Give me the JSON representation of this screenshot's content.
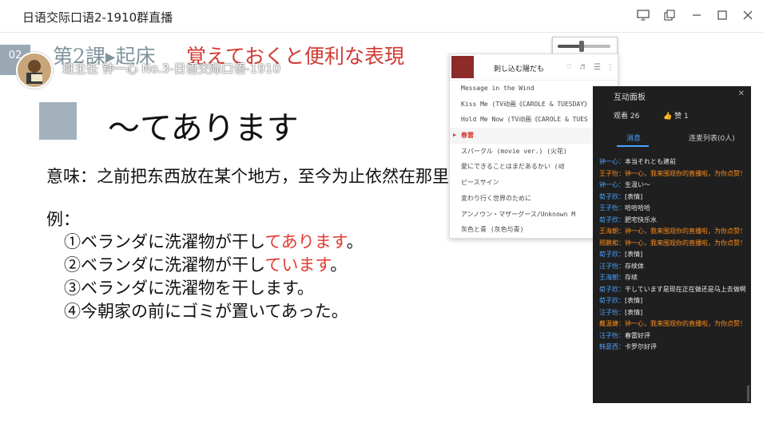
{
  "window": {
    "title": "日语交际口语2-1910群直播"
  },
  "slide": {
    "page_number": "02",
    "lesson_title": "第2課▸起床",
    "expression_title": "覚えておくと便利な表現",
    "channel_overlay": "班主任 钟一心 No.3-日语交际口语-1910",
    "heading": "～てあります",
    "meaning": "意味：之前把东西放在某个地方，至今为止依然在那里放着。",
    "example_label": "例：",
    "examples": [
      {
        "prefix": "①ベランダに洗濯物が干し",
        "red": "てあります",
        "suffix": "。"
      },
      {
        "prefix": "②ベランダに洗濯物が干し",
        "red": "ています",
        "suffix": "。"
      },
      {
        "prefix": "③ベランダに洗濯物を干します。",
        "red": "",
        "suffix": ""
      },
      {
        "prefix": "④今朝家の前にゴミが置いてあった。",
        "red": "",
        "suffix": ""
      }
    ]
  },
  "music": {
    "now_playing": "刺し込む陽だも",
    "volume_percent": 45,
    "tracks": [
      {
        "label": "Message in the Wind",
        "active": false
      },
      {
        "label": "Kiss Me  (TV动画《CAROLE & TUESDAY》",
        "active": false
      },
      {
        "label": "Hold Me Now  (TV动画《CAROLE & TUES",
        "active": false
      },
      {
        "label": "春雷",
        "active": true
      },
      {
        "label": "スパークル (movie ver.) (火花)",
        "active": false
      },
      {
        "label": "愛にできることはまだあるかい  (动",
        "active": false
      },
      {
        "label": "ピースサイン",
        "active": false
      },
      {
        "label": "変わり行く世界のために",
        "active": false
      },
      {
        "label": "アンノウン・マザーグース/Unknown M",
        "active": false
      },
      {
        "label": "灰色と青  (灰色与青)",
        "active": false
      }
    ]
  },
  "chat": {
    "title": "互动面板",
    "viewers": "观看 26",
    "likes": "赞 1",
    "tab_messages": "消息",
    "tab_mic": "连麦列表(0人)",
    "messages": [
      {
        "name": "钟一心",
        "name_color": "blue",
        "text": "本当それとも建前",
        "text_color": "white"
      },
      {
        "name": "王子怡",
        "name_color": "orange",
        "text": "钟一心，我来围观你的直播啦，为你点赞！",
        "text_color": "orange"
      },
      {
        "name": "钟一心",
        "name_color": "blue",
        "text": "生温い～",
        "text_color": "white"
      },
      {
        "name": "荀子欣",
        "name_color": "blue",
        "text": "[表情]",
        "text_color": "white"
      },
      {
        "name": "王子怡",
        "name_color": "blue",
        "text": "哈哈哈哈",
        "text_color": "white"
      },
      {
        "name": "荀子欣",
        "name_color": "blue",
        "text": "肥宅快乐水",
        "text_color": "white"
      },
      {
        "name": "王海朝",
        "name_color": "orange",
        "text": "钟一心，我来围观你的直播啦，为你点赞！",
        "text_color": "orange"
      },
      {
        "name": "邢鹏和",
        "name_color": "orange",
        "text": "钟一心，我来围观你的直播啦，为你点赞！",
        "text_color": "orange"
      },
      {
        "name": "荀子欣",
        "name_color": "blue",
        "text": "[表情]",
        "text_color": "white"
      },
      {
        "name": "汪子怡",
        "name_color": "blue",
        "text": "存续体",
        "text_color": "white"
      },
      {
        "name": "王海朝",
        "name_color": "blue",
        "text": "存续",
        "text_color": "white"
      },
      {
        "name": "荀子欣",
        "name_color": "blue",
        "text": "干しています是现在正在做还是马上去做啊",
        "text_color": "white"
      },
      {
        "name": "荀子欣",
        "name_color": "blue",
        "text": "[表情]",
        "text_color": "white"
      },
      {
        "name": "汪子怡",
        "name_color": "blue",
        "text": "[表情]",
        "text_color": "white"
      },
      {
        "name": "戴温婕",
        "name_color": "orange",
        "text": "钟一心，我来围观你的直播啦，为你点赞！",
        "text_color": "orange"
      },
      {
        "name": "汪子怡",
        "name_color": "blue",
        "text": "春雷好评",
        "text_color": "white"
      },
      {
        "name": "韩意西",
        "name_color": "blue",
        "text": "卡罗尔好评",
        "text_color": "white"
      }
    ]
  }
}
